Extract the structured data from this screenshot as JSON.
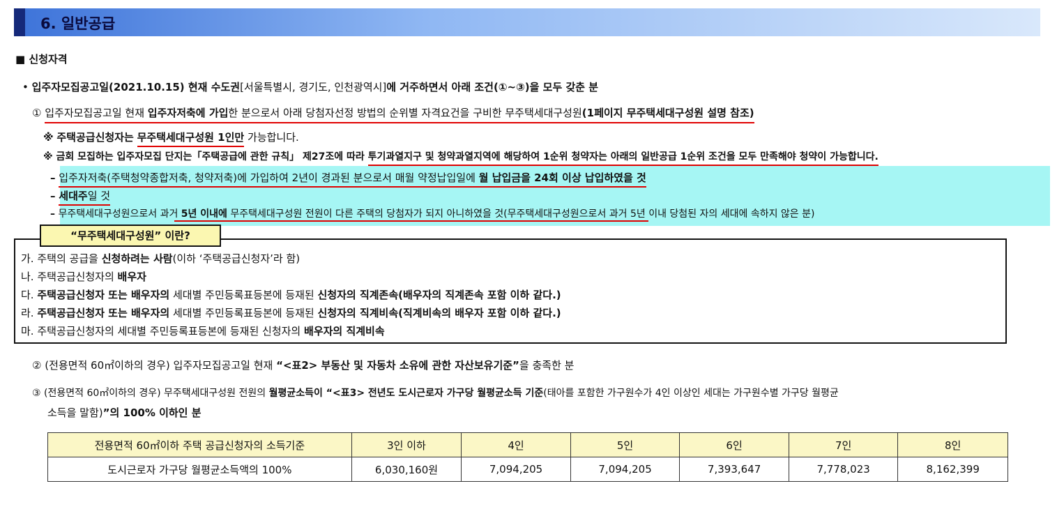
{
  "section": {
    "number_title": "6. 일반공급"
  },
  "qualification_heading": "■ 신청자격",
  "intro": {
    "bullet": "•",
    "a": "입주자모집공고일(2021.10.15) 현재 수도권",
    "b": "[서울특별시, 경기도, 인천광역시]",
    "c": "에 거주하면서 아래 조건(①~③)을 모두 갖춘 분"
  },
  "cond1": {
    "num": "①",
    "a": "입주자모집공고일 현재",
    "b": "입주자저축에 가입",
    "c": "한 분으로서 아래 당첨자선정 방법의 순위별 자격요건을 구비한 무주택세대구성원",
    "d": "(1페이지 무주택세대구성원 설명 참조)"
  },
  "note1": {
    "mark": "※",
    "a": "주택공급신청자는",
    "b": "무주택세대구성원 1인만",
    "c": "가능합니다."
  },
  "note2": {
    "mark": "※",
    "a": "금회 모집하는 입주자모집 단지는「주택공급에 관한 규칙」 제27조에 따라",
    "b": "투기과열지구 및 청약과열지역에 해당하여 1순위 청약자는 아래의 일반공급 1순위 조건을 모두 만족해야 청약이 가능합니다."
  },
  "dash1": {
    "mark": "–",
    "a": "입주자저축(주택청약종합저축, 청약저축)에 가입하여 2년이 경과된 분으로서 매월 약정납입일에",
    "b": "월 납입금을 24회 이상 납입하였을 것"
  },
  "dash2": {
    "mark": "–",
    "a": "세대주",
    "b": "일 것"
  },
  "dash3": {
    "mark": "–",
    "a": "무주택세대구성원으로서 과거",
    "b": "5년 이내에",
    "c": "무주택세대구성원 전원이 다른 주택의 당첨자가 되지 아니하였을 것(무주택세대구성원으로서 과거 5년 이내 당첨된 자의 세대에 속하지 않은 분)"
  },
  "definition": {
    "title": "“무주택세대구성원” 이란?",
    "ga": {
      "label": "가.",
      "a": "주택의 공급을",
      "b": "신청하려는 사람",
      "c": "(이하 ‘주택공급신청자’라 함)"
    },
    "na": {
      "label": "나.",
      "a": "주택공급신청자의",
      "b": "배우자"
    },
    "da": {
      "label": "다.",
      "a": "주택공급신청자 또는 배우자의",
      "b": "세대별 주민등록표등본에 등재된",
      "c": "신청자의 직계존속(배우자의 직계존속 포함 이하 같다.)"
    },
    "ra": {
      "label": "라.",
      "a": "주택공급신청자 또는 배우자의",
      "b": "세대별 주민등록표등본에 등재된",
      "c": "신청자의 직계비속(직계비속의 배우자 포함 이하 같다.)"
    },
    "ma": {
      "label": "마.",
      "a": "주택공급신청자의 세대별 주민등록표등본에 등재된 신청자의",
      "b": "배우자의 직계비속"
    }
  },
  "cond2": {
    "num": "②",
    "a": "(전용면적 60㎡이하의 경우) 입주자모집공고일 현재",
    "b": "“<표2> 부동산 및 자동차 소유에 관한 자산보유기준”",
    "c": "을 충족한 분"
  },
  "cond3": {
    "num": "③",
    "a": "(전용면적 60㎡이하의 경우) 무주택세대구성원 전원의",
    "b": "월평균소득이 “<표3> 전년도 도시근로자 가구당 월평균소득 기준",
    "c": "(태아를 포함한 가구원수가 4인 이상인 세대는 가구원수별 가구당 월평균",
    "d": "소득을 말함)",
    "e": "”의 100% 이하인 분"
  },
  "income_table": {
    "header": [
      "전용면적 60㎡이하 주택 공급신청자의 소득기준",
      "3인 이하",
      "4인",
      "5인",
      "6인",
      "7인",
      "8인"
    ],
    "row": [
      "도시근로자 가구당 월평균소득액의 100%",
      "6,030,160원",
      "7,094,205",
      "7,094,205",
      "7,393,647",
      "7,778,023",
      "8,162,399"
    ]
  }
}
